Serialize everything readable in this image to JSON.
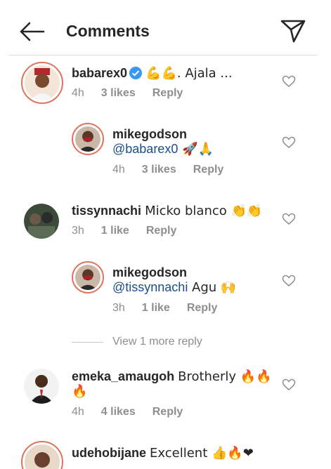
{
  "header": {
    "title": "Comments"
  },
  "comments": [
    {
      "user": "babarex0",
      "verified": true,
      "text": "💪💪. Ajala ...",
      "time": "4h",
      "likes": "3 likes",
      "reply": "Reply"
    },
    {
      "user": "mikegodson",
      "mention": "@babarex0",
      "text": " 🚀🙏",
      "time": "4h",
      "likes": "3 likes",
      "reply": "Reply"
    },
    {
      "user": "tissynnachi",
      "text": "Micko blanco 👏👏",
      "time": "3h",
      "likes": "1 like",
      "reply": "Reply"
    },
    {
      "user": "mikegodson",
      "mention": "@tissynnachi",
      "text": " Agu 🙌",
      "time": "3h",
      "likes": "1 like",
      "reply": "Reply"
    },
    {
      "user": "emeka_amaugoh",
      "text": "Brotherly 🔥🔥",
      "text2": "🔥",
      "time": "4h",
      "likes": "4 likes",
      "reply": "Reply"
    },
    {
      "user": "udehobijane",
      "text": "Excellent 👍🔥❤"
    }
  ],
  "view_more": "View 1 more reply",
  "icons": {
    "back": "arrow-left-icon",
    "send": "send-paper-plane-icon",
    "like": "heart-outline-icon",
    "verified": "verified-badge-icon"
  },
  "colors": {
    "accent": "#3897f0",
    "ring": "#e0735b",
    "muted": "#8e8e8e",
    "mention": "#1b4f8a"
  }
}
